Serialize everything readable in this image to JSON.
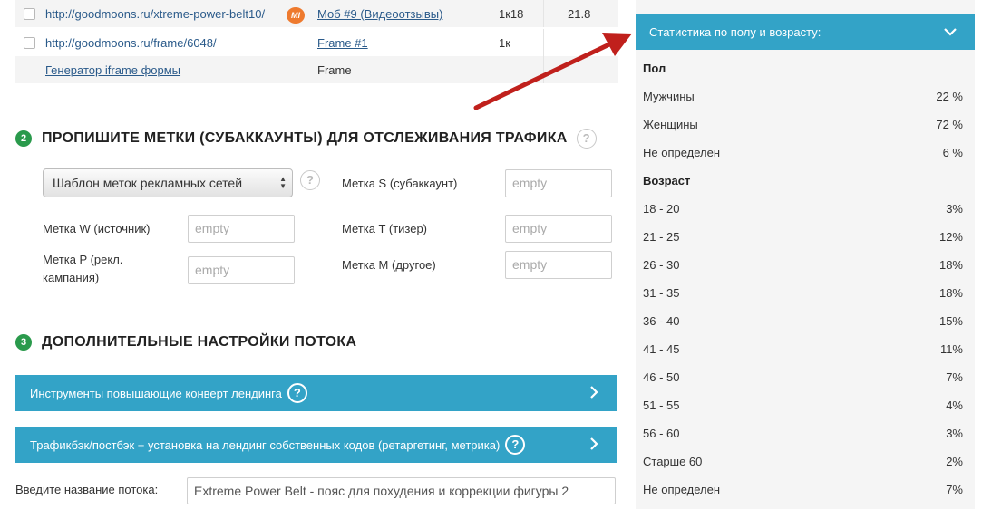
{
  "links": [
    {
      "url": "http://goodmoons.ru/xtreme-power-belt10/",
      "badge": "MI",
      "name": "Моб #9 (Видеоотзывы)",
      "c1": "1к18",
      "c2": "21.8"
    },
    {
      "url": "http://goodmoons.ru/frame/6048/",
      "name": "Frame #1",
      "c1": "1к",
      "c2": ""
    },
    {
      "url": "Генератор iframe формы",
      "name": "Frame",
      "c1": "",
      "c2": ""
    }
  ],
  "section2": {
    "num": "2",
    "title": "Пропишите метки (субаккаунты) для отслеживания трафика",
    "help": "?",
    "template_select": "Шаблон меток рекламных сетей",
    "fields": {
      "w_label": "Метка W (источник)",
      "p_label_1": "Метка P (рекл.",
      "p_label_2": "кампания)",
      "s_label": "Метка S (субаккаунт)",
      "t_label": "Метка T (тизер)",
      "m_label": "Метка M (другое)",
      "placeholder": "empty"
    }
  },
  "section3": {
    "num": "3",
    "title": "Дополнительные настройки потока",
    "bar1": "Инструменты повышающие конверт лендинга",
    "bar2": "Трафикбэк/постбэк + установка на лендинг собственных кодов (ретаргетинг, метрика)",
    "help": "?",
    "stream_label": "Введите название потока:",
    "stream_value": "Extreme Power Belt - пояс для похудения и коррекции фигуры 2"
  },
  "stats": {
    "header": "Статистика по полу и возрасту:",
    "gender_title": "Пол",
    "gender": [
      {
        "label": "Мужчины",
        "value": "22 %"
      },
      {
        "label": "Женщины",
        "value": "72 %"
      },
      {
        "label": "Не определен",
        "value": "6 %"
      }
    ],
    "age_title": "Возраст",
    "age": [
      {
        "label": "18 - 20",
        "value": "3%"
      },
      {
        "label": "21 - 25",
        "value": "12%"
      },
      {
        "label": "26 - 30",
        "value": "18%"
      },
      {
        "label": "31 - 35",
        "value": "18%"
      },
      {
        "label": "36 - 40",
        "value": "15%"
      },
      {
        "label": "41 - 45",
        "value": "11%"
      },
      {
        "label": "46 - 50",
        "value": "7%"
      },
      {
        "label": "51 - 55",
        "value": "4%"
      },
      {
        "label": "56 - 60",
        "value": "3%"
      },
      {
        "label": "Старше 60",
        "value": "2%"
      },
      {
        "label": "Не определен",
        "value": "7%"
      }
    ]
  },
  "colors": {
    "accent": "#33a3c7",
    "arrow": "#c0201c",
    "step": "#2a9a4c",
    "badge": "#ee7a2e"
  }
}
